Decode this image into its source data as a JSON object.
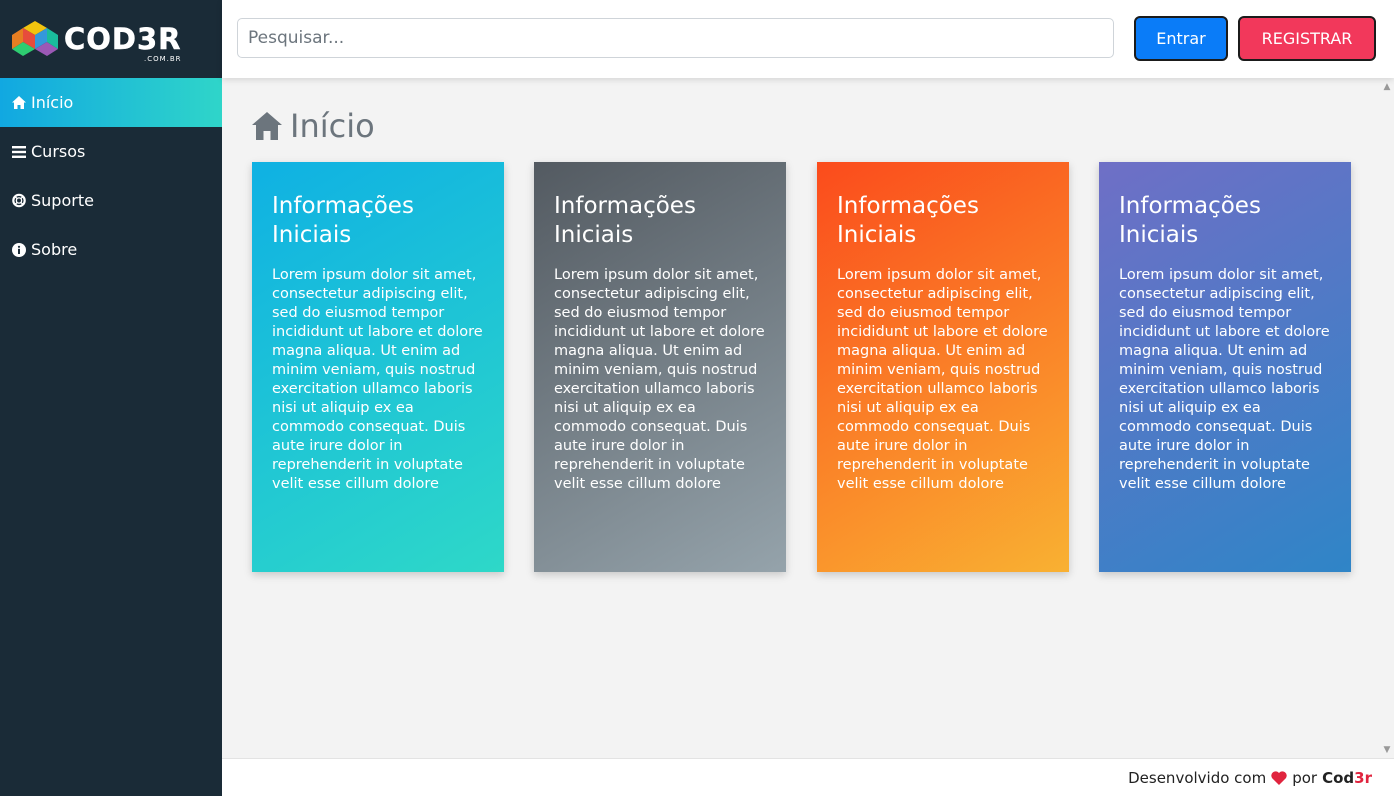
{
  "logo": {
    "text": "COD3R",
    "subtext": ".COM.BR"
  },
  "search": {
    "placeholder": "Pesquisar..."
  },
  "header": {
    "login_label": "Entrar",
    "register_label": "REGISTRAR"
  },
  "sidebar": {
    "items": [
      {
        "label": "Início",
        "icon": "home-icon",
        "active": true
      },
      {
        "label": "Cursos",
        "icon": "bars-icon",
        "active": false
      },
      {
        "label": "Suporte",
        "icon": "life-ring-icon",
        "active": false
      },
      {
        "label": "Sobre",
        "icon": "info-circle-icon",
        "active": false
      }
    ]
  },
  "page": {
    "title": "Início",
    "title_icon": "home-icon"
  },
  "cards": [
    {
      "title": "Informações Iniciais",
      "body": "Lorem ipsum dolor sit amet, consectetur adipiscing elit, sed do eiusmod tempor incididunt ut labore et dolore magna aliqua. Ut enim ad minim veniam, quis nostrud exercitation ullamco laboris nisi ut aliquip ex ea commodo consequat. Duis aute irure dolor in reprehenderit in voluptate velit esse cillum dolore",
      "gradient": [
        "#0fb1e3",
        "#2ed8c8"
      ]
    },
    {
      "title": "Informações Iniciais",
      "body": "Lorem ipsum dolor sit amet, consectetur adipiscing elit, sed do eiusmod tempor incididunt ut labore et dolore magna aliqua. Ut enim ad minim veniam, quis nostrud exercitation ullamco laboris nisi ut aliquip ex ea commodo consequat. Duis aute irure dolor in reprehenderit in voluptate velit esse cillum dolore",
      "gradient": [
        "#535a61",
        "#95a3ab"
      ]
    },
    {
      "title": "Informações Iniciais",
      "body": "Lorem ipsum dolor sit amet, consectetur adipiscing elit, sed do eiusmod tempor incididunt ut labore et dolore magna aliqua. Ut enim ad minim veniam, quis nostrud exercitation ullamco laboris nisi ut aliquip ex ea commodo consequat. Duis aute irure dolor in reprehenderit in voluptate velit esse cillum dolore",
      "gradient": [
        "#fb4b1c",
        "#f9b132"
      ]
    },
    {
      "title": "Informações Iniciais",
      "body": "Lorem ipsum dolor sit amet, consectetur adipiscing elit, sed do eiusmod tempor incididunt ut labore et dolore magna aliqua. Ut enim ad minim veniam, quis nostrud exercitation ullamco laboris nisi ut aliquip ex ea commodo consequat. Duis aute irure dolor in reprehenderit in voluptate velit esse cillum dolore",
      "gradient": [
        "#6f6fc6",
        "#2f85c7"
      ]
    }
  ],
  "footer": {
    "prefix": "Desenvolvido com",
    "by": "por",
    "brand_main": "Cod",
    "brand_accent": "3r"
  },
  "colors": {
    "sidebar_bg": "#1a2b37",
    "login_button": "#0a7cf8",
    "register_button": "#f2385b",
    "heart": "#e0243e"
  }
}
